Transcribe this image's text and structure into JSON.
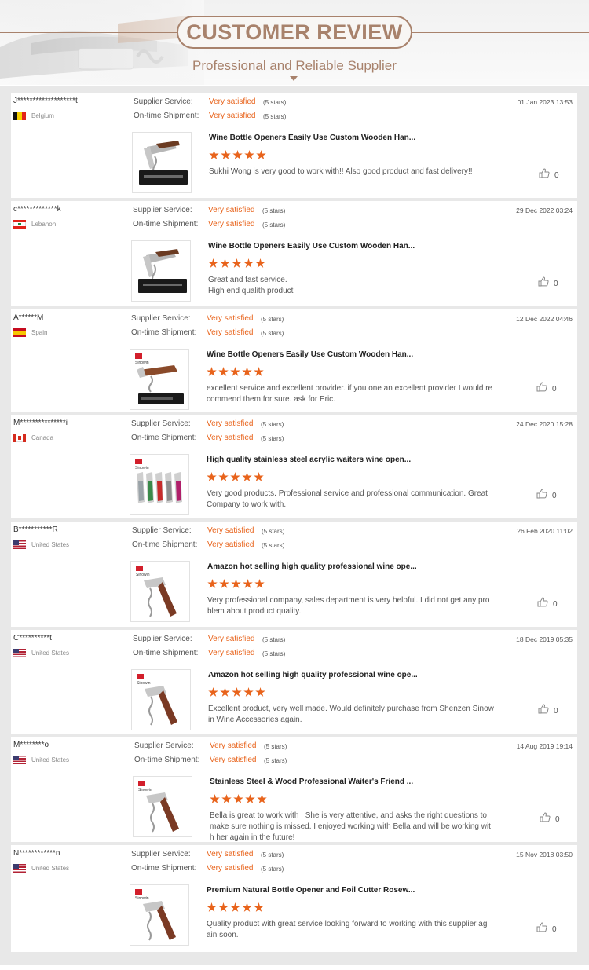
{
  "header": {
    "title": "CUSTOMER REVIEW",
    "subtitle": "Professional and Reliable Supplier"
  },
  "labels": {
    "supplier_service": "Supplier Service:",
    "ontime_shipment": "On-time Shipment:"
  },
  "colors": {
    "accent": "#a8826c",
    "rating": "#e8631b"
  },
  "reviews": [
    {
      "reviewer": "J*******************t",
      "country": "Belgium",
      "flag": "belgium-flag",
      "supplier_service": "Very satisfied",
      "supplier_stars": "(5 stars)",
      "shipment": "Very satisfied",
      "shipment_stars": "(5 stars)",
      "date": "01 Jan 2023 13:53",
      "product": "Wine Bottle Openers Easily Use Custom Wooden Han...",
      "rating": 5,
      "comment": "Sukhi Wong is very good to work with!! Also good product and fast delivery!!",
      "likes": "0",
      "thumbnail": "wine-opener-in-black-box"
    },
    {
      "reviewer": "c*************k",
      "country": "Lebanon",
      "flag": "lebanon-flag",
      "supplier_service": "Very satisfied",
      "supplier_stars": "(5 stars)",
      "shipment": "Very satisfied",
      "shipment_stars": "(5 stars)",
      "date": "29 Dec 2022 03:24",
      "product": "Wine Bottle Openers Easily Use Custom Wooden Han...",
      "rating": 5,
      "comment": "Great and fast service.\nHigh end qualith product",
      "likes": "0",
      "thumbnail": "wine-opener-in-black-box"
    },
    {
      "reviewer": "A******M",
      "country": "Spain",
      "flag": "spain-flag",
      "supplier_service": "Very satisfied",
      "supplier_stars": "(5 stars)",
      "shipment": "Very satisfied",
      "shipment_stars": "(5 stars)",
      "date": "12 Dec 2022 04:46",
      "product": "Wine Bottle Openers Easily Use Custom Wooden Han...",
      "rating": 5,
      "comment": "excellent service and excellent provider. if you one an excellent provider I would re\ncommend them for sure. ask for Eric.",
      "likes": "0",
      "thumbnail": "sinowin-opener-with-box",
      "brand": "Sinowin"
    },
    {
      "reviewer": "M***************i",
      "country": "Canada",
      "flag": "canada-flag",
      "supplier_service": "Very satisfied",
      "supplier_stars": "(5 stars)",
      "shipment": "Very satisfied",
      "shipment_stars": "(5 stars)",
      "date": "24 Dec 2020 15:28",
      "product": "High quality stainless steel acrylic waiters wine open...",
      "rating": 5,
      "comment": "Very good products. Professional service and professional communication. Great\nCompany to work with.",
      "likes": "0",
      "thumbnail": "sinowin-colored-openers",
      "brand": "Sinowin"
    },
    {
      "reviewer": "B***********R",
      "country": "United States",
      "flag": "us-flag",
      "supplier_service": "Very satisfied",
      "supplier_stars": "(5 stars)",
      "shipment": "Very satisfied",
      "shipment_stars": "(5 stars)",
      "date": "26 Feb 2020 11:02",
      "product": "Amazon hot selling high quality professional wine ope...",
      "rating": 5,
      "comment": "Very professional company, sales department is very helpful. I did not get any pro\nblem about product quality.",
      "likes": "0",
      "thumbnail": "sinowin-opener",
      "brand": "Sinowin"
    },
    {
      "reviewer": "C**********t",
      "country": "United States",
      "flag": "us-flag",
      "supplier_service": "Very satisfied",
      "supplier_stars": "(5 stars)",
      "shipment": "Very satisfied",
      "shipment_stars": "(5 stars)",
      "date": "18 Dec 2019 05:35",
      "product": "Amazon hot selling high quality professional wine ope...",
      "rating": 5,
      "comment": "Excellent product, very well made. Would definitely purchase from Shenzen Sinow\nin Wine Accessories again.",
      "likes": "0",
      "thumbnail": "sinowin-opener",
      "brand": "Sinowin"
    },
    {
      "reviewer": "M********o",
      "country": "United States",
      "flag": "us-flag",
      "supplier_service": "Very satisfied",
      "supplier_stars": "(5 stars)",
      "shipment": "Very satisfied",
      "shipment_stars": "(5 stars)",
      "date": "14 Aug 2019 19:14",
      "product": "Stainless Steel & Wood Professional Waiter's Friend ...",
      "rating": 5,
      "comment": "Bella is great to work with .  She is very attentive, and asks the right questions to\nmake sure nothing is missed.  I enjoyed working with Bella and will be working wit\nh her again in the future!",
      "likes": "0",
      "thumbnail": "sinowin-opener",
      "brand": "Sinowin"
    },
    {
      "reviewer": "N************n",
      "country": "United States",
      "flag": "us-flag",
      "supplier_service": "Very satisfied",
      "supplier_stars": "(5 stars)",
      "shipment": "Very satisfied",
      "shipment_stars": "(5 stars)",
      "date": "15 Nov 2018 03:50",
      "product": "Premium Natural Bottle Opener and Foil Cutter Rosew...",
      "rating": 5,
      "comment": "Quality product with great service looking forward to working with this supplier ag\nain soon.",
      "likes": "0",
      "thumbnail": "sinowin-opener",
      "brand": "Sinowin"
    }
  ]
}
